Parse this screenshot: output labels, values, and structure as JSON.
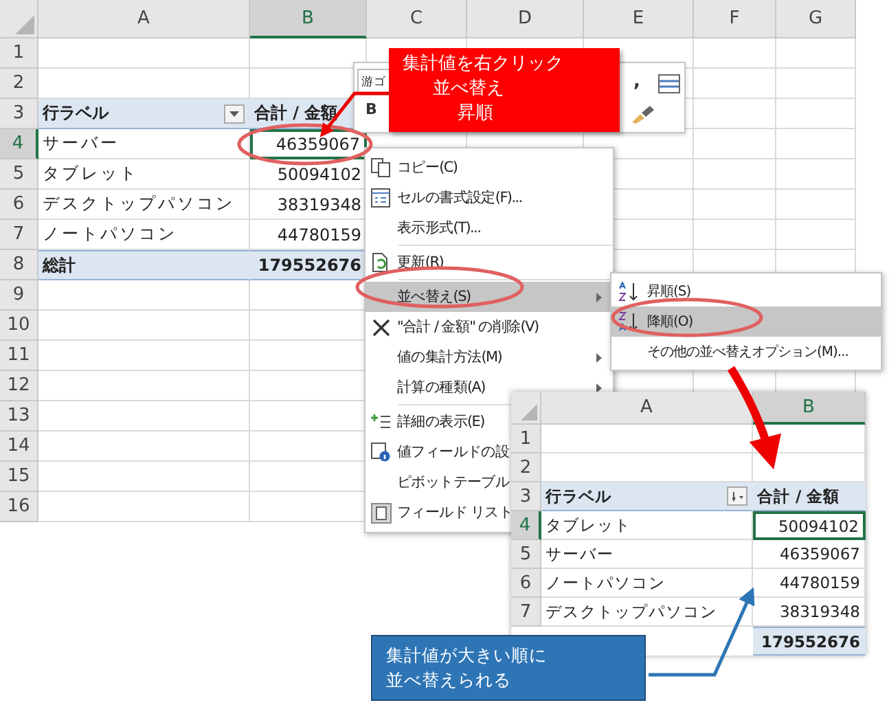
{
  "sheet": {
    "columns": [
      {
        "label": "A",
        "selected": false
      },
      {
        "label": "B",
        "selected": true
      },
      {
        "label": "C",
        "selected": false
      },
      {
        "label": "D",
        "selected": false
      },
      {
        "label": "E",
        "selected": false
      },
      {
        "label": "F",
        "selected": false
      },
      {
        "label": "G",
        "selected": false
      }
    ],
    "rows": [
      {
        "label": "1",
        "selected": false
      },
      {
        "label": "2",
        "selected": false
      },
      {
        "label": "3",
        "selected": false
      },
      {
        "label": "4",
        "selected": true
      },
      {
        "label": "5",
        "selected": false
      },
      {
        "label": "6",
        "selected": false
      },
      {
        "label": "7",
        "selected": false
      },
      {
        "label": "8",
        "selected": false
      },
      {
        "label": "9",
        "selected": false
      },
      {
        "label": "10",
        "selected": false
      },
      {
        "label": "11",
        "selected": false
      },
      {
        "label": "12",
        "selected": false
      },
      {
        "label": "13",
        "selected": false
      },
      {
        "label": "14",
        "selected": false
      },
      {
        "label": "15",
        "selected": false
      },
      {
        "label": "16",
        "selected": false
      }
    ],
    "pivot": {
      "row_header": "行ラベル",
      "value_header": "合計 / 金額",
      "rows": [
        {
          "label": "サーバー",
          "value": "46359067",
          "selected": true
        },
        {
          "label": "タブレット",
          "value": "50094102",
          "selected": false
        },
        {
          "label": "デスクトップパソコン",
          "value": "38319348",
          "selected": false
        },
        {
          "label": "ノートパソコン",
          "value": "44780159",
          "selected": false
        }
      ],
      "total": {
        "label": "総計",
        "value": "179552676"
      }
    }
  },
  "mini_toolbar": {
    "font": "游ゴ",
    "bold": "B",
    "comma": ","
  },
  "context_menu": {
    "items": [
      {
        "kind": "item",
        "label": "コピー(C)",
        "highlighted": false
      },
      {
        "kind": "item",
        "label": "セルの書式設定(F)...",
        "highlighted": false
      },
      {
        "kind": "item",
        "label": "表示形式(T)...",
        "highlighted": false
      },
      {
        "kind": "separator"
      },
      {
        "kind": "item",
        "label": "更新(R)",
        "highlighted": false
      },
      {
        "kind": "separator"
      },
      {
        "kind": "submenu",
        "label": "並べ替え(S)",
        "highlighted": true
      },
      {
        "kind": "item",
        "label": "\"合計 / 金額\" の削除(V)",
        "highlighted": false
      },
      {
        "kind": "submenu",
        "label": "値の集計方法(M)",
        "highlighted": false
      },
      {
        "kind": "submenu",
        "label": "計算の種類(A)",
        "highlighted": false
      },
      {
        "kind": "separator"
      },
      {
        "kind": "item",
        "label": "詳細の表示(E)",
        "highlighted": false
      },
      {
        "kind": "item",
        "label": "値フィールドの設",
        "highlighted": false
      },
      {
        "kind": "item",
        "label": "ピボットテーブル",
        "highlighted": false
      },
      {
        "kind": "item",
        "label": "フィールド リスト",
        "highlighted": false
      }
    ]
  },
  "submenu": {
    "items": [
      {
        "label": "昇順(S)",
        "highlighted": false
      },
      {
        "label": "降順(O)",
        "highlighted": true
      },
      {
        "label": "その他の並べ替えオプション(M)...",
        "highlighted": false
      }
    ]
  },
  "result_sheet": {
    "columns": [
      {
        "label": "A",
        "selected": false
      },
      {
        "label": "B",
        "selected": true
      }
    ],
    "rows": [
      {
        "label": "1",
        "selected": false
      },
      {
        "label": "2",
        "selected": false
      },
      {
        "label": "3",
        "selected": false
      },
      {
        "label": "4",
        "selected": true
      },
      {
        "label": "5",
        "selected": false
      },
      {
        "label": "6",
        "selected": false
      },
      {
        "label": "7",
        "selected": false
      }
    ],
    "pivot": {
      "row_header": "行ラベル",
      "value_header": "合計 / 金額",
      "rows": [
        {
          "label": "タブレット",
          "value": "50094102",
          "selected": true
        },
        {
          "label": "サーバー",
          "value": "46359067",
          "selected": false
        },
        {
          "label": "ノートパソコン",
          "value": "44780159",
          "selected": false
        },
        {
          "label": "デスクトップパソコン",
          "value": "38319348",
          "selected": false
        }
      ],
      "total": {
        "value": "179552676"
      }
    }
  },
  "callouts": [
    {
      "kind": "instruction",
      "lines": [
        "集計値を右クリック",
        "並べ替え",
        "昇順"
      ]
    },
    {
      "kind": "result",
      "lines": [
        "集計値が大きい順に",
        "並べ替えられる"
      ]
    }
  ]
}
